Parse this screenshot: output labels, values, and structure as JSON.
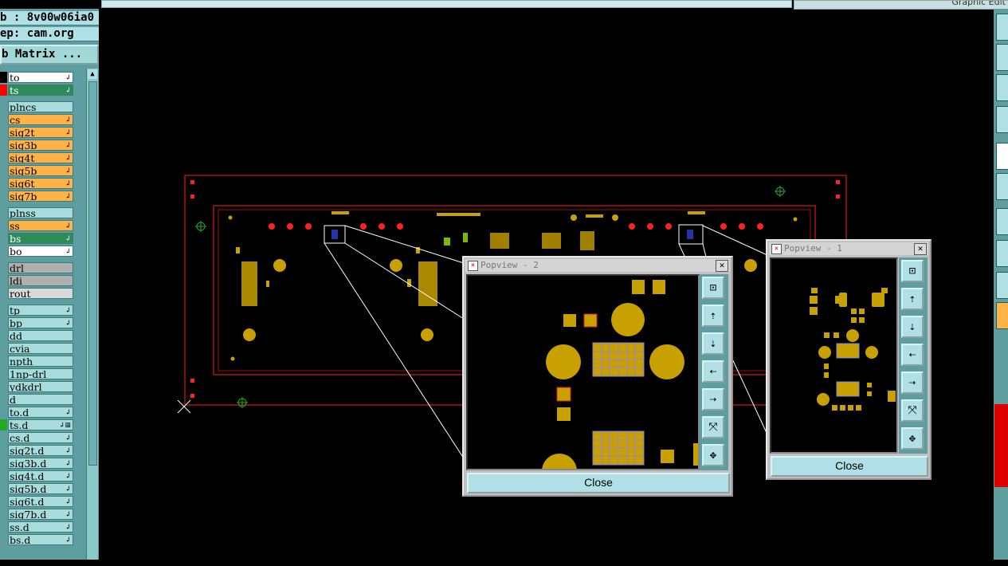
{
  "header": {
    "job_label": "b : 8v00w06ia0",
    "step_label": "ep: cam.org",
    "matrix_button": "b Matrix ...",
    "graphic_title": "Graphic Edit"
  },
  "layers": [
    {
      "label": "to",
      "swatch": "#000000",
      "bg": "#ffffff",
      "arrow": "↲"
    },
    {
      "label": "ts",
      "swatch": "#ff0000",
      "bg": "#2e8b57",
      "arrow": "↲"
    },
    {
      "label": "plncs",
      "swatch": "",
      "bg": "#a8dcdc",
      "arrow": ""
    },
    {
      "label": "cs",
      "swatch": "",
      "bg": "#ffb347",
      "arrow": "↲"
    },
    {
      "label": "sig2t",
      "swatch": "",
      "bg": "#ffb347",
      "arrow": "↲"
    },
    {
      "label": "sig3b",
      "swatch": "",
      "bg": "#ffb347",
      "arrow": "↲"
    },
    {
      "label": "sig4t",
      "swatch": "",
      "bg": "#ffb347",
      "arrow": "↲"
    },
    {
      "label": "sig5b",
      "swatch": "",
      "bg": "#ffb347",
      "arrow": "↲"
    },
    {
      "label": "sig6t",
      "swatch": "",
      "bg": "#ffb347",
      "arrow": "↲"
    },
    {
      "label": "sig7b",
      "swatch": "",
      "bg": "#ffb347",
      "arrow": "↲"
    },
    {
      "label": "plnss",
      "swatch": "",
      "bg": "#a8dcdc",
      "arrow": ""
    },
    {
      "label": "ss",
      "swatch": "",
      "bg": "#ffb347",
      "arrow": "↲"
    },
    {
      "label": "bs",
      "swatch": "",
      "bg": "#2e8b57",
      "arrow": "↲"
    },
    {
      "label": "bo",
      "swatch": "",
      "bg": "#ffffff",
      "arrow": "↲"
    },
    {
      "label": "drl",
      "swatch": "",
      "bg": "#b0b0b0",
      "arrow": ""
    },
    {
      "label": "ldi",
      "swatch": "",
      "bg": "#b0b0b0",
      "arrow": ""
    },
    {
      "label": "rout",
      "swatch": "",
      "bg": "#d9d9d9",
      "arrow": ""
    },
    {
      "label": "tp",
      "swatch": "",
      "bg": "#a8dcdc",
      "arrow": "↲"
    },
    {
      "label": "bp",
      "swatch": "",
      "bg": "#a8dcdc",
      "arrow": "↲"
    },
    {
      "label": "dd",
      "swatch": "",
      "bg": "#a8dcdc",
      "arrow": ""
    },
    {
      "label": "cvia",
      "swatch": "",
      "bg": "#a8dcdc",
      "arrow": ""
    },
    {
      "label": "npth",
      "swatch": "",
      "bg": "#a8dcdc",
      "arrow": ""
    },
    {
      "label": "1np-drl",
      "swatch": "",
      "bg": "#a8dcdc",
      "arrow": ""
    },
    {
      "label": "ydkdrl",
      "swatch": "",
      "bg": "#a8dcdc",
      "arrow": ""
    },
    {
      "label": "d",
      "swatch": "",
      "bg": "#a8dcdc",
      "arrow": ""
    },
    {
      "label": "to.d",
      "swatch": "",
      "bg": "#a8dcdc",
      "arrow": "↲"
    },
    {
      "label": "ts.d",
      "swatch": "#22aa22",
      "bg": "#a8dcdc",
      "arrow": "↲⊞"
    },
    {
      "label": "cs.d",
      "swatch": "",
      "bg": "#a8dcdc",
      "arrow": "↲"
    },
    {
      "label": "sig2t.d",
      "swatch": "",
      "bg": "#a8dcdc",
      "arrow": "↲"
    },
    {
      "label": "sig3b.d",
      "swatch": "",
      "bg": "#a8dcdc",
      "arrow": "↲"
    },
    {
      "label": "sig4t.d",
      "swatch": "",
      "bg": "#a8dcdc",
      "arrow": "↲"
    },
    {
      "label": "sig5b.d",
      "swatch": "",
      "bg": "#a8dcdc",
      "arrow": "↲"
    },
    {
      "label": "sig6t.d",
      "swatch": "",
      "bg": "#a8dcdc",
      "arrow": "↲"
    },
    {
      "label": "sig7b.d",
      "swatch": "",
      "bg": "#a8dcdc",
      "arrow": "↲"
    },
    {
      "label": "ss.d",
      "swatch": "",
      "bg": "#a8dcdc",
      "arrow": "↲"
    },
    {
      "label": "bs.d",
      "swatch": "",
      "bg": "#a8dcdc",
      "arrow": "↲"
    }
  ],
  "popview2": {
    "title": "Popview - 2",
    "close_label": "Close"
  },
  "popview1": {
    "title": "Popview - 1",
    "close_label": "Close"
  },
  "popview_tools": [
    "zoom-fit-icon",
    "pan-up-icon",
    "pan-down-icon",
    "pan-left-icon",
    "pan-right-icon",
    "zoom-out-icon",
    "zoom-in-icon"
  ],
  "colors": {
    "pad": "#c8a000",
    "outline": "#ff2020",
    "fiducial": "#22aa22",
    "background": "#000000",
    "panel": "#5f9ea0"
  }
}
